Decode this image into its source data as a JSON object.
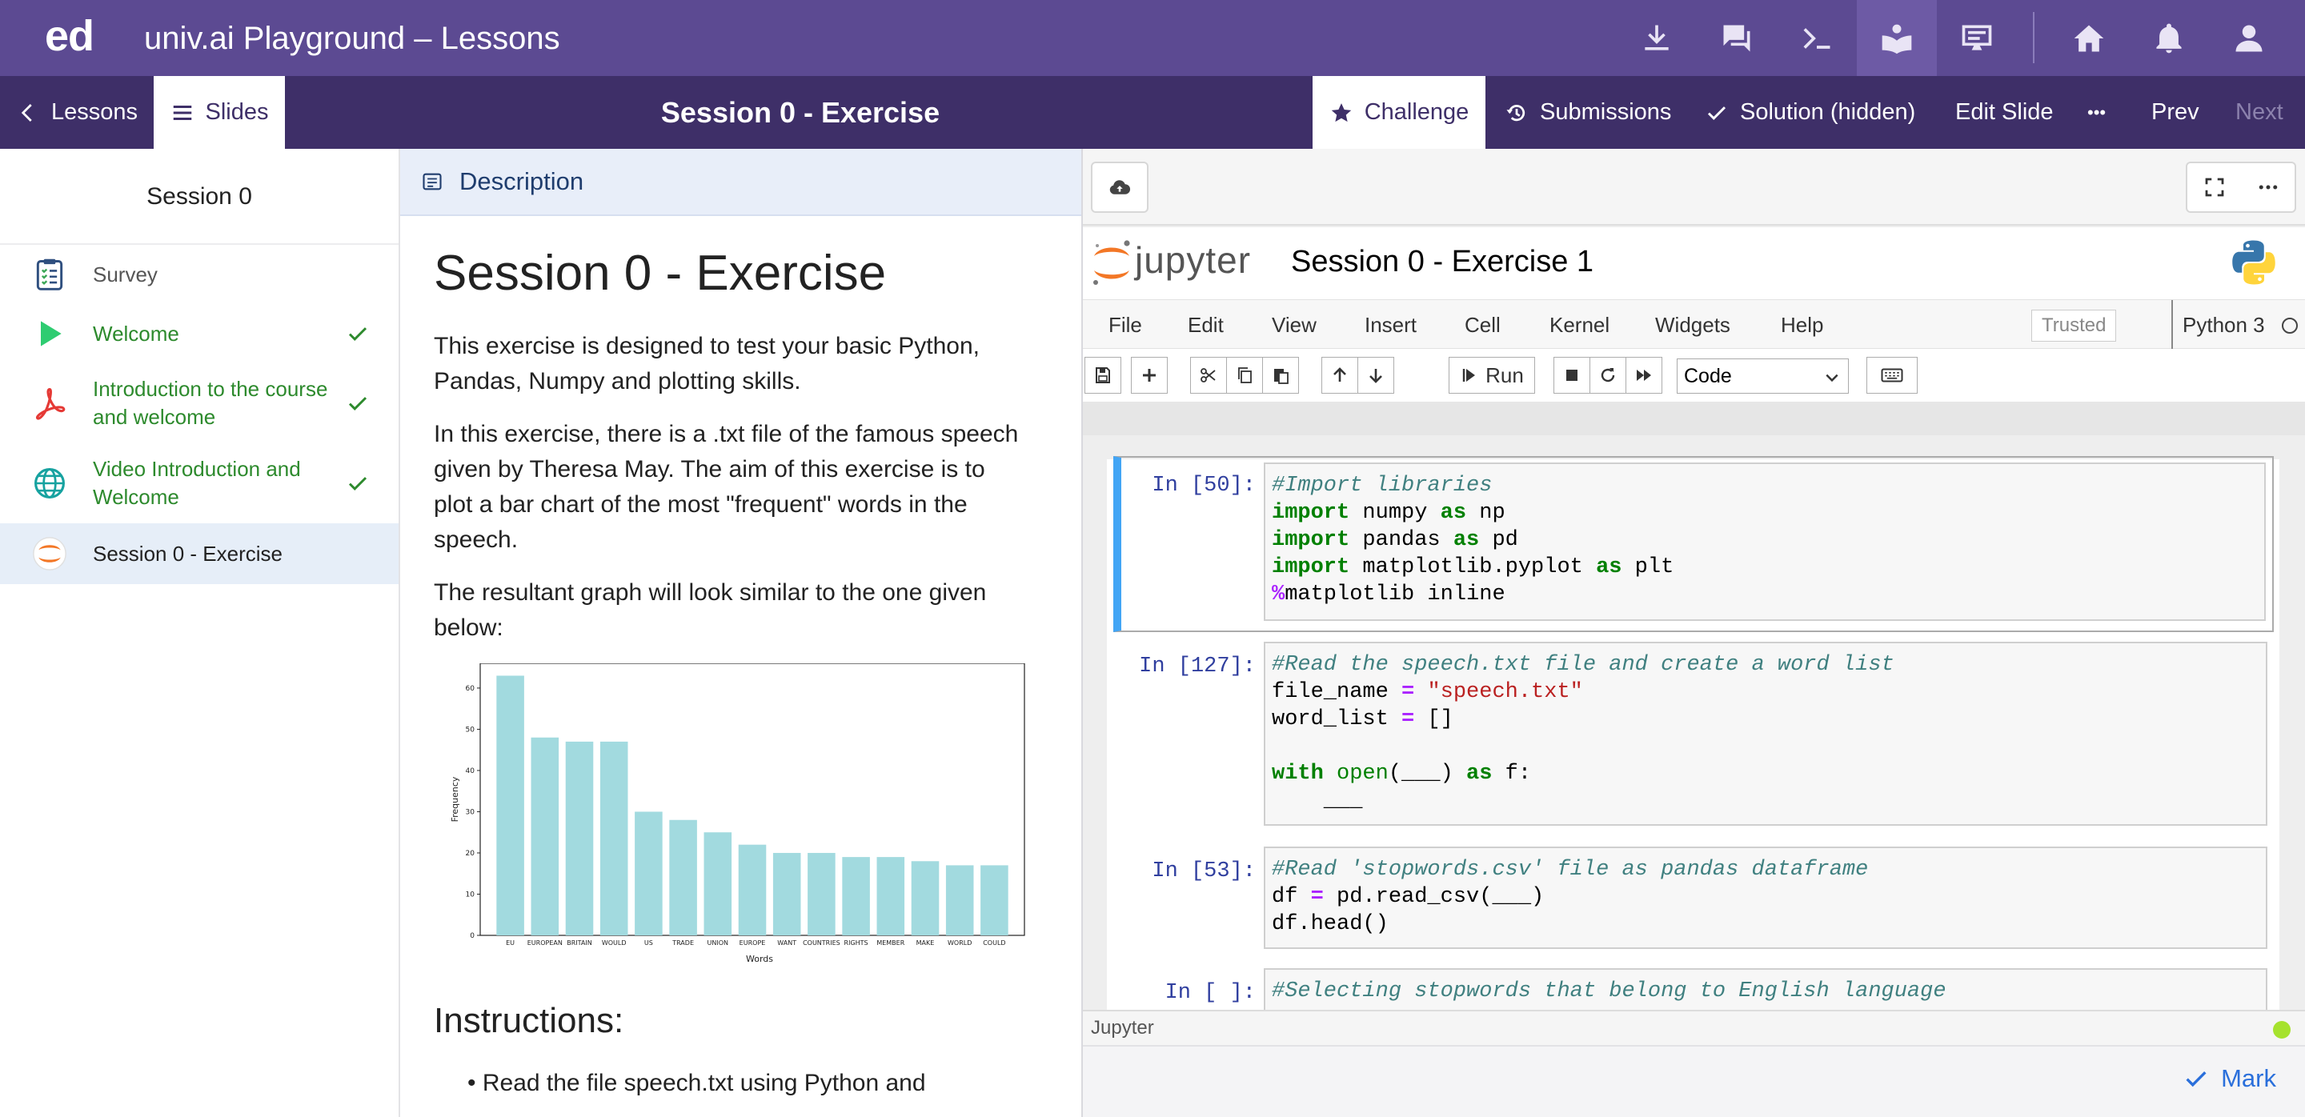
{
  "topbar": {
    "logo": "ed",
    "title": "univ.ai Playground – Lessons",
    "icons": [
      "download-icon",
      "chat-icon",
      "terminal-icon",
      "lessons-icon",
      "slides-icon",
      "home-icon",
      "bell-icon",
      "user-icon"
    ]
  },
  "subbar": {
    "lessons_label": "Lessons",
    "slides_label": "Slides",
    "session_title": "Session 0 - Exercise",
    "challenge_label": "Challenge",
    "submissions_label": "Submissions",
    "solution_label": "Solution (hidden)",
    "edit_slide_label": "Edit Slide",
    "more_label": "•••",
    "prev_label": "Prev",
    "next_label": "Next"
  },
  "sidebar": {
    "title": "Session 0",
    "items": [
      {
        "label": "Survey",
        "icon": "clipboard-icon",
        "done": false
      },
      {
        "label": "Welcome",
        "icon": "play-icon",
        "done": true
      },
      {
        "label": "Introduction to the course and welcome",
        "icon": "pdf-icon",
        "done": true
      },
      {
        "label": "Video Introduction and Welcome",
        "icon": "globe-icon",
        "done": true
      },
      {
        "label": "Session 0 - Exercise",
        "icon": "jupyter-icon",
        "done": false
      }
    ]
  },
  "description": {
    "header_label": "Description",
    "title": "Session 0 - Exercise",
    "para1": "This exercise is designed to test your basic Python, Pandas, Numpy and plotting skills.",
    "para2": "In this exercise, there is a .txt file of the famous speech given by Theresa May. The aim of this exercise is to plot a bar chart of the most \"frequent\" words in the speech.",
    "para3": "The resultant graph will look similar to the one given below:",
    "instructions_title": "Instructions:",
    "instruction_1": "Read the file speech.txt using Python and"
  },
  "chart_data": {
    "type": "bar",
    "categories": [
      "EU",
      "EUROPEAN",
      "BRITAIN",
      "WOULD",
      "US",
      "TRADE",
      "UNION",
      "EUROPE",
      "WANT",
      "COUNTRIES",
      "RIGHTS",
      "MEMBER",
      "MAKE",
      "WORLD",
      "COULD"
    ],
    "values": [
      63,
      48,
      47,
      47,
      30,
      28,
      25,
      22,
      20,
      20,
      19,
      19,
      18,
      17,
      17
    ],
    "xlabel": "Words",
    "ylabel": "Frequency",
    "ylim": [
      0,
      66
    ],
    "yticks": [
      0,
      10,
      20,
      30,
      40,
      50,
      60
    ],
    "bar_color": "#a2dadf",
    "grid": false
  },
  "jupyter": {
    "logo_text": "jupyter",
    "notebook_title": "Session 0 - Exercise 1",
    "menus": [
      "File",
      "Edit",
      "View",
      "Insert",
      "Cell",
      "Kernel",
      "Widgets",
      "Help"
    ],
    "trusted_label": "Trusted",
    "kernel_label": "Python 3",
    "run_label": "Run",
    "cell_type": "Code",
    "footer_label": "Jupyter",
    "cells": [
      {
        "prompt": "In [50]:"
      },
      {
        "prompt": "In [127]:"
      },
      {
        "prompt": "In [53]:"
      },
      {
        "prompt": "In [ ]:"
      }
    ],
    "code": {
      "c1_l1": "#Import libraries",
      "c1_l2_kw": "import",
      "c1_l2_a": " numpy ",
      "c1_l2_as": "as",
      "c1_l2_b": " np",
      "c1_l3_kw": "import",
      "c1_l3_a": " pandas ",
      "c1_l3_as": "as",
      "c1_l3_b": " pd",
      "c1_l4_kw": "import",
      "c1_l4_a": " matplotlib.pyplot ",
      "c1_l4_as": "as",
      "c1_l4_b": " plt",
      "c1_l5_op": "%",
      "c1_l5_a": "matplotlib inline",
      "c2_l1": "#Read the speech.txt file and create a word list",
      "c2_l2_a": "file_name ",
      "c2_l2_op": "=",
      "c2_l2_str": "\"speech.txt\"",
      "c2_l3_a": "word_list ",
      "c2_l3_op": "=",
      "c2_l3_b": " []",
      "c2_l5_kw": "with",
      "c2_l5_bi": "open",
      "c2_l5_a": "(___) ",
      "c2_l5_as": "as",
      "c2_l5_b": " f:",
      "c2_l6": "    ___",
      "c3_l1": "#Read 'stopwords.csv' file as pandas dataframe",
      "c3_l2_a": "df ",
      "c3_l2_op": "=",
      "c3_l2_b": " pd.read_csv(___)",
      "c3_l3": "df.head()",
      "c4_l1": "#Selecting stopwords that belong to English language"
    }
  },
  "mark_label": "Mark",
  "colors": {
    "topbar": "#5c4a92",
    "subbar": "#3e2f68",
    "complete_green": "#2d8a2d",
    "link_blue": "#2a6fdb"
  }
}
